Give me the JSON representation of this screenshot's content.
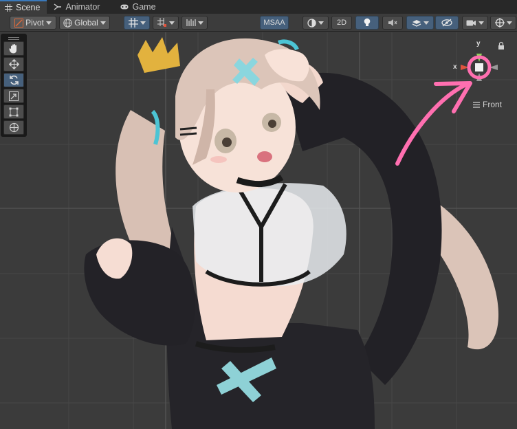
{
  "tabs": [
    {
      "label": "Scene",
      "icon": "grid-icon",
      "active": true
    },
    {
      "label": "Animator",
      "icon": "animator-icon",
      "active": false
    },
    {
      "label": "Game",
      "icon": "gamepad-icon",
      "active": false
    }
  ],
  "toolbar": {
    "pivot_label": "Pivot",
    "global_label": "Global",
    "msaa_label": "MSAA",
    "mode_2d_label": "2D"
  },
  "tools": [
    "hand-tool",
    "move-tool",
    "rotate-tool",
    "scale-tool",
    "rect-tool",
    "transform-tool"
  ],
  "active_tool": "rotate-tool",
  "gizmo": {
    "view_label": "Front",
    "y_axis": "y",
    "x_axis": "x"
  },
  "colors": {
    "accent_blue": "#46607c",
    "annotation_pink": "#ff6fb0",
    "y_axis_green": "#8fd35a",
    "x_axis_red": "#e0533d"
  }
}
